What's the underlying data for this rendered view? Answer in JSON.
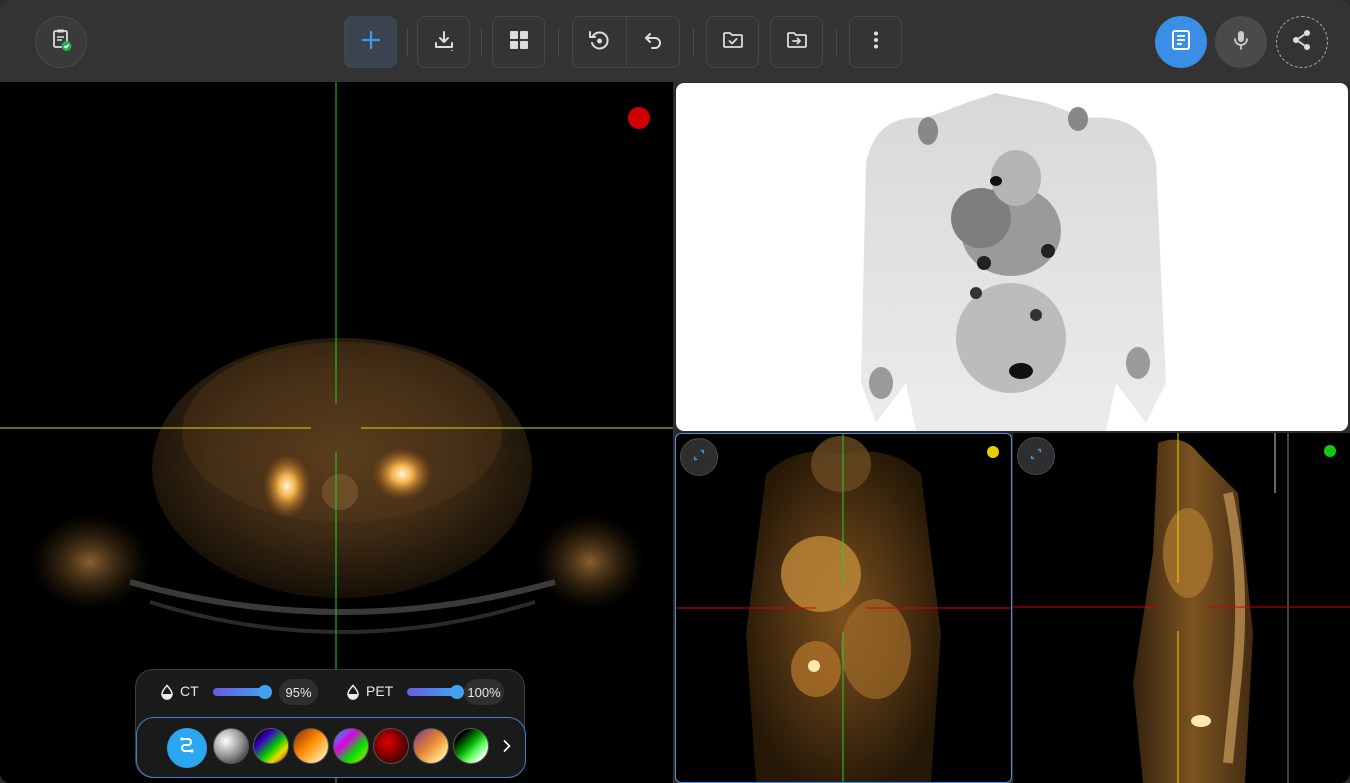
{
  "toolbar": {
    "left_icon": "clipboard-check-icon",
    "buttons": [
      {
        "name": "add",
        "icon": "plus-icon"
      },
      {
        "name": "download",
        "icon": "download-icon"
      },
      {
        "name": "layout",
        "icon": "grid-icon"
      },
      {
        "name": "reset",
        "icon": "reset-view-icon"
      },
      {
        "name": "undo",
        "icon": "undo-icon"
      },
      {
        "name": "folder-check",
        "icon": "folder-check-icon"
      },
      {
        "name": "folder-export",
        "icon": "folder-export-icon"
      },
      {
        "name": "more",
        "icon": "more-vertical-icon"
      }
    ],
    "right": [
      "report-icon",
      "microphone-icon",
      "share-icon"
    ],
    "accent": "#3a8ee6"
  },
  "viewports": {
    "axial": {
      "indicator_color": "#d10000"
    },
    "mip": {},
    "coronal": {
      "indicator_color": "#e6d200"
    },
    "sagittal": {
      "indicator_color": "#14c814"
    }
  },
  "fusion": {
    "ct_label": "CT",
    "ct_percent": "95%",
    "ct_value": 0.95,
    "pet_label": "PET",
    "pet_percent": "100%",
    "pet_value": 1.0,
    "colormaps": [
      "grayscale",
      "rainbow",
      "hot-iron",
      "spectral",
      "red-hot",
      "gold",
      "green-fire"
    ],
    "next_icon": "chevron-right-icon",
    "link_icon": "link-icon"
  }
}
